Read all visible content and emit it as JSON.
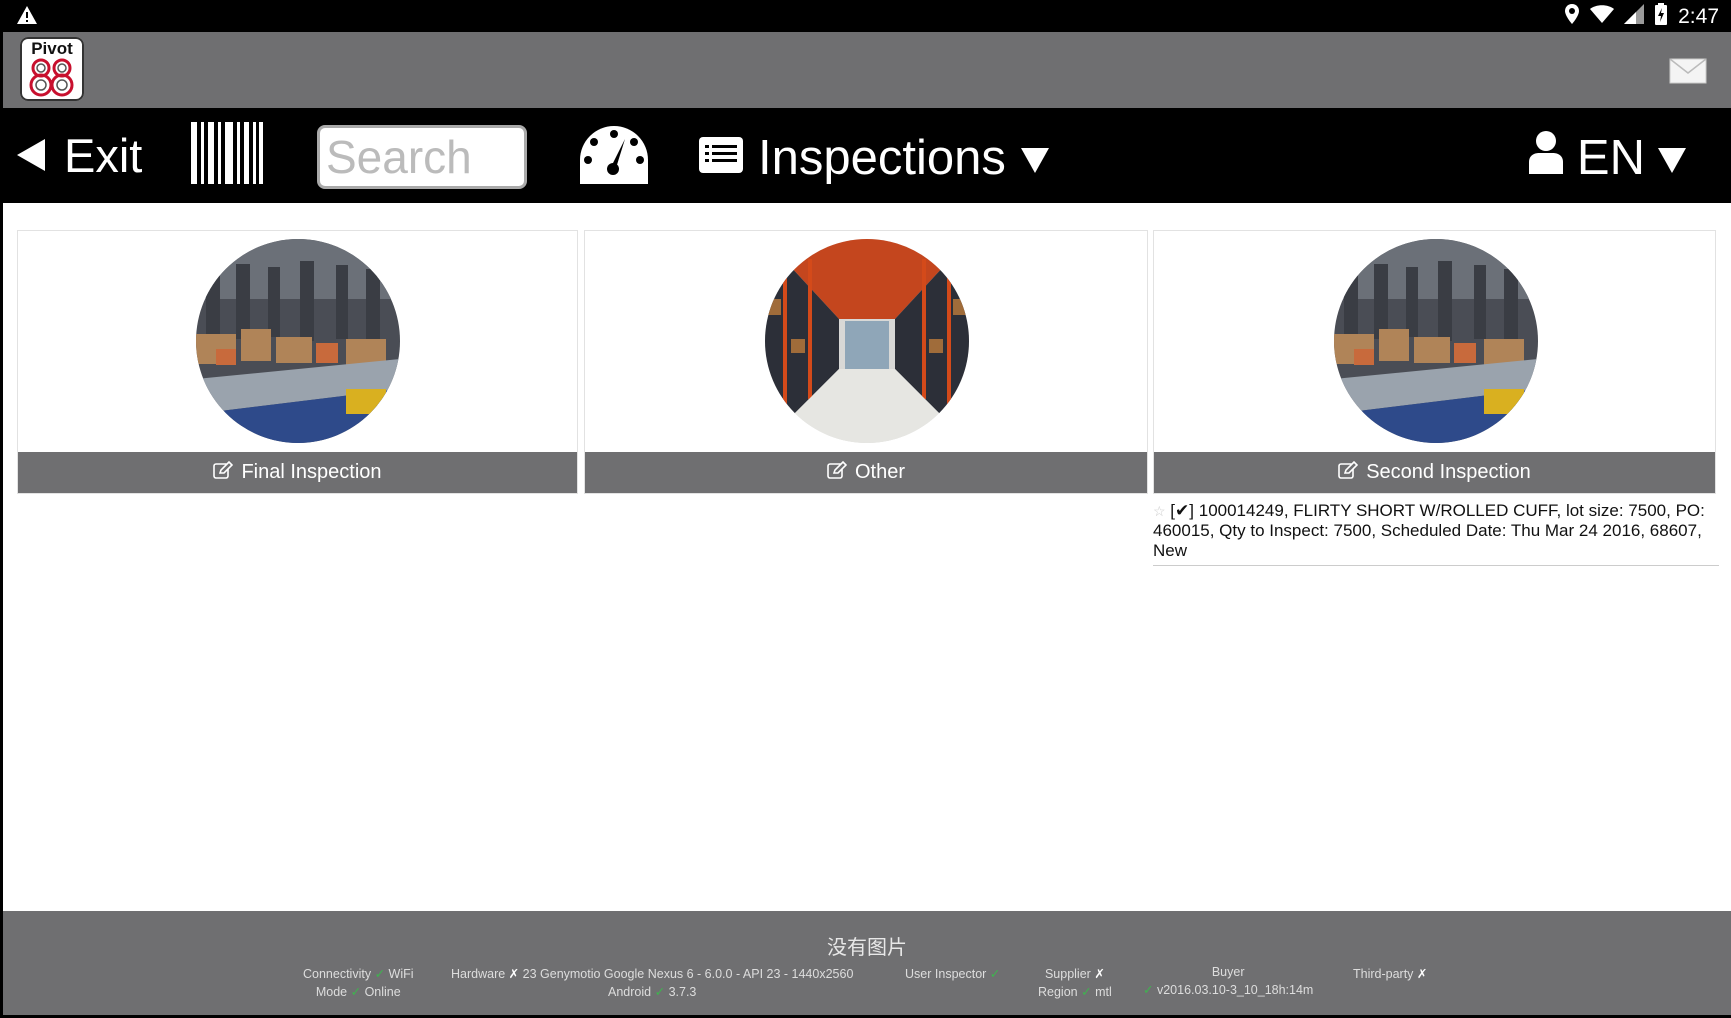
{
  "status_bar": {
    "time": "2:47"
  },
  "header": {
    "logo_text": "Pivot",
    "logo_number": "88"
  },
  "toolbar": {
    "exit_label": "Exit",
    "search_placeholder": "Search",
    "module_label": "Inspections",
    "language_label": "EN"
  },
  "cards": [
    {
      "label": "Final Inspection"
    },
    {
      "label": "Other"
    },
    {
      "label": "Second Inspection"
    }
  ],
  "inspection_list": [
    {
      "check": "[✔]",
      "text": "100014249, FLIRTY SHORT W/ROLLED CUFF, lot size: 7500, PO: 460015, Qty to Inspect: 7500, Scheduled Date: Thu Mar 24 2016, 68607, New"
    }
  ],
  "footer": {
    "no_image": "没有图片",
    "connectivity_label": "Connectivity",
    "connectivity_value": "WiFi",
    "mode_label": "Mode",
    "mode_value": "Online",
    "hardware_label": "Hardware",
    "hardware_value": "23 Genymotio Google Nexus 6 - 6.0.0 - API 23 - 1440x2560",
    "android_label": "Android",
    "android_value": "3.7.3",
    "user_label": "User",
    "user_value": "Inspector",
    "supplier_label": "Supplier",
    "region_label": "Region",
    "region_value": "mtl",
    "buyer_label": "Buyer",
    "version": "v2016.03.10-3_10_18h:14m",
    "thirdparty_label": "Third-party",
    "ok_mark": "✓",
    "bad_mark": "✗"
  }
}
